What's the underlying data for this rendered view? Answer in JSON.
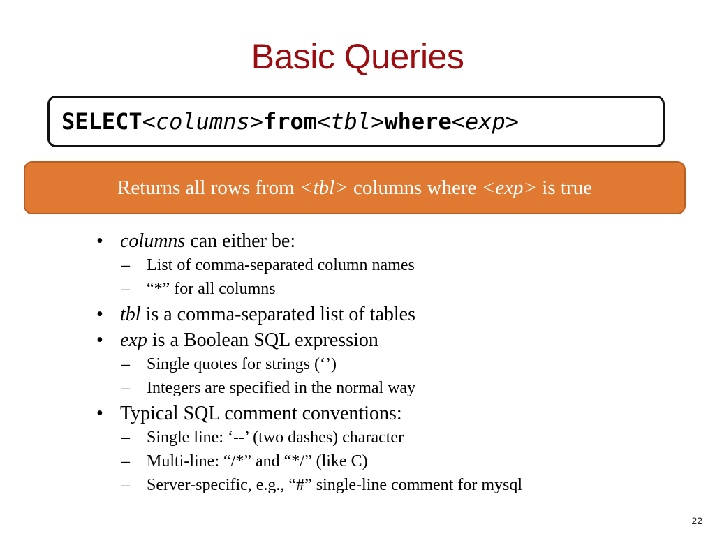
{
  "slide": {
    "title": "Basic Queries",
    "page_number": "22"
  },
  "syntax": {
    "select_kw": "SELECT",
    "columns_ph": "<columns>",
    "from_kw": "from",
    "tbl_ph": "<tbl>",
    "where_kw": "where",
    "exp_ph": "<exp>"
  },
  "summary": {
    "part1": "Returns all rows from ",
    "tbl": "<tbl>",
    "part2": " columns where ",
    "exp": "<exp>",
    "part3": " is true",
    "background_color": "#e07a32"
  },
  "bullets": [
    {
      "italic": "columns",
      "text": " can either be:",
      "sub": [
        "List of comma-separated column names",
        "“*” for all columns"
      ]
    },
    {
      "italic": "tbl",
      "text": " is a comma-separated list of tables",
      "sub": []
    },
    {
      "italic": "exp",
      "text": " is a Boolean SQL expression",
      "sub": [
        "Single quotes for strings (‘’)",
        "Integers are specified in the normal way"
      ]
    },
    {
      "italic": "",
      "text": "Typical SQL comment conventions:",
      "sub": [
        "Single line: ‘--’ (two dashes) character",
        "Multi-line: “/*” and “*/” (like C)",
        "Server-specific, e.g., “#” single-line comment for mysql"
      ]
    }
  ],
  "markers": {
    "bullet": "•",
    "dash": "–"
  },
  "colors": {
    "title": "#9b0d10",
    "accent": "#e07a32"
  }
}
